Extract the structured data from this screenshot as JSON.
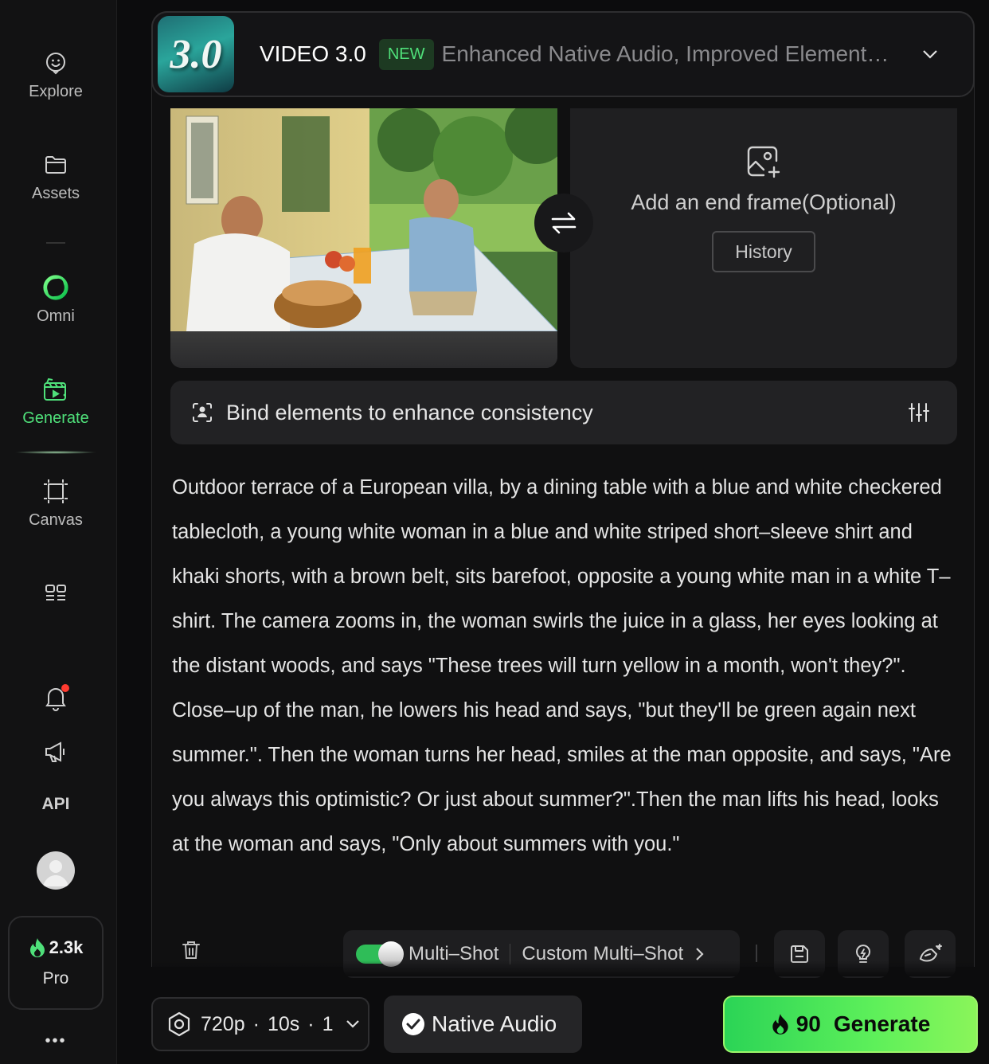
{
  "sidebar": {
    "items": [
      {
        "label": "Explore",
        "icon": "explore-icon"
      },
      {
        "label": "Assets",
        "icon": "folder-icon"
      },
      {
        "label": "Omni",
        "icon": "omni-ring-icon"
      },
      {
        "label": "Generate",
        "icon": "generate-icon",
        "active": true
      },
      {
        "label": "Canvas",
        "icon": "canvas-icon"
      }
    ],
    "api_label": "API",
    "credits": "2.3k",
    "plan": "Pro",
    "more": "•••",
    "accent_color": "#4fe07a",
    "notification_dot_color": "#ff3b30"
  },
  "model": {
    "logo_text": "3.0",
    "name": "VIDEO 3.0",
    "badge": "NEW",
    "description": "Enhanced Native Audio, Improved Element…"
  },
  "frames": {
    "end_frame_text": "Add an end frame(Optional)",
    "history_label": "History"
  },
  "bind": {
    "label": "Bind elements to enhance consistency"
  },
  "prompt": {
    "text": "Outdoor terrace of a European villa, by a dining table with a blue and white checkered tablecloth, a young white woman in a blue and white striped short–sleeve shirt and khaki shorts, with a brown belt, sits barefoot, opposite a young white man in a white T–shirt. The camera zooms in, the woman swirls the juice in a glass, her eyes looking at the distant woods, and says \"These trees will turn yellow in a month, won't they?\". Close–up of the man, he lowers his head and says, \"but they'll be green again next summer.\". Then the woman turns her head, smiles at the man opposite, and says, \"Are you always this optimistic? Or just about summer?\".Then the man lifts his head, looks at the woman and says, \"Only about summers with you.\""
  },
  "tools": {
    "multi_shot_label": "Multi–Shot",
    "multi_shot_enabled": true,
    "custom_multi_shot_label": "Custom Multi–Shot"
  },
  "bottom": {
    "settings_resolution": "720p",
    "settings_duration": "10s",
    "settings_count": "1",
    "native_audio_label": "Native Audio",
    "native_audio_enabled": true,
    "generate_cost": "90",
    "generate_label": "Generate"
  }
}
